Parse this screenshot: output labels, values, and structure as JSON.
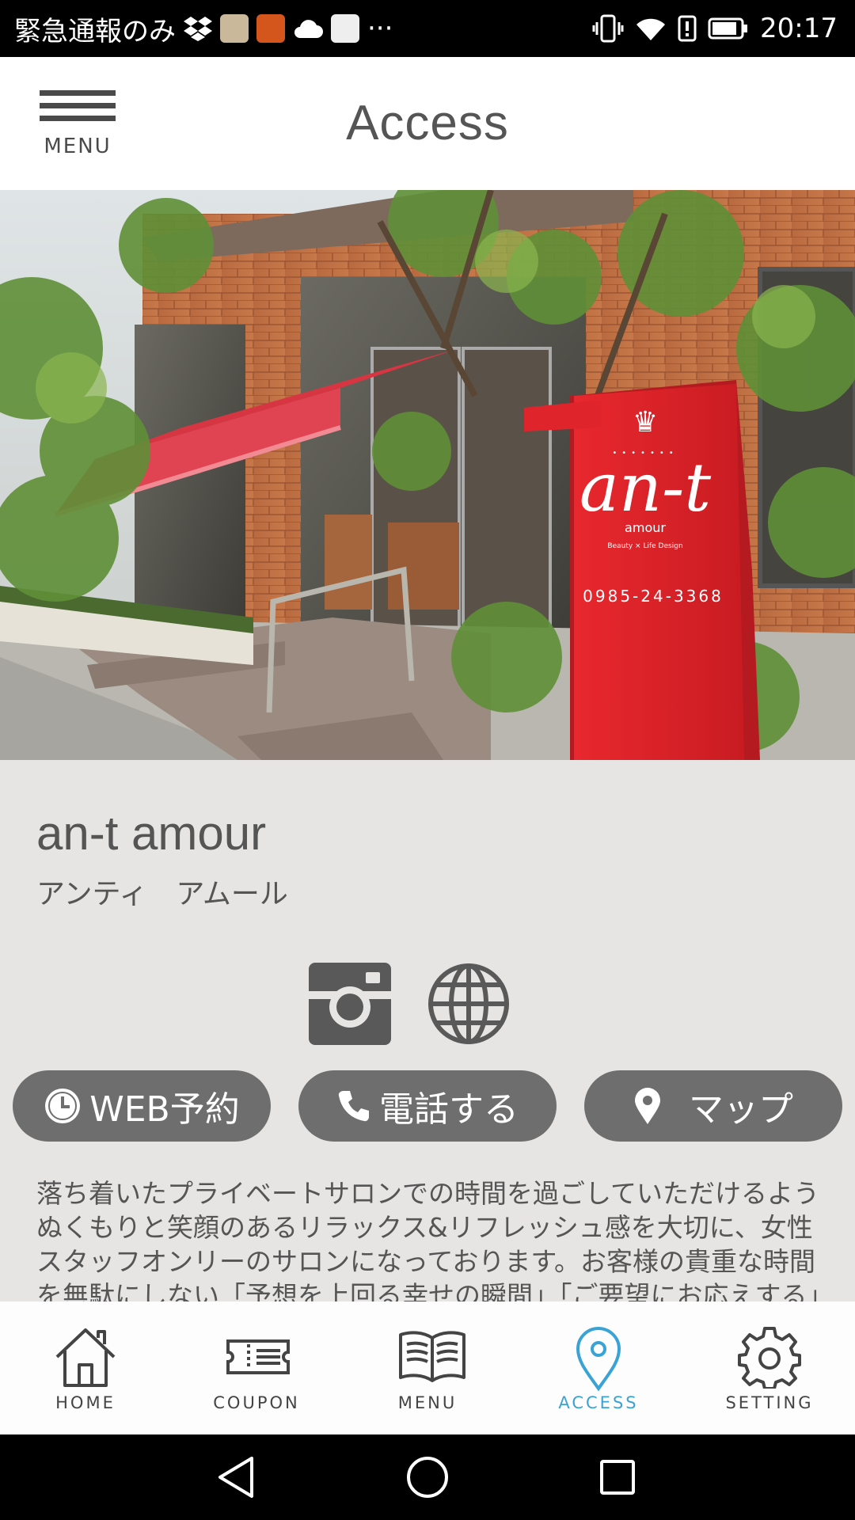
{
  "status_bar": {
    "carrier_text": "緊急通報のみ",
    "overflow": "···",
    "time": "20:17",
    "icons": [
      "dropbox-icon",
      "allure-app-icon",
      "app-icon",
      "cloud-icon",
      "lekiya-app-icon",
      "vibrate-icon",
      "wifi-icon",
      "alert-icon",
      "battery-icon"
    ]
  },
  "header": {
    "menu_label": "MENU",
    "title": "Access"
  },
  "hero": {
    "sign_brand": "an-t",
    "sign_sub": "amour",
    "sign_tagline": "Beauty × Life Design",
    "sign_phone": "0985-24-3368"
  },
  "shop": {
    "name": "an-t amour",
    "kana": "アンティ　アムール"
  },
  "social": [
    "instagram-icon",
    "globe-icon"
  ],
  "actions": {
    "web_reserve": "WEB予約",
    "call": "電話する",
    "map": "マップ"
  },
  "description": "落ち着いたプライベートサロンでの時間を過ごしていただけるようぬくもりと笑顔のあるリラックス&リフレッシュ感を大切に、女性スタッフオンリーのサロンになっております。お客様の貴重な時間を無駄にしない「予想を上回る幸せの瞬間」「ご要望にお応えする」をコンセプトに、クオリティーの高いデザインで喜びと感動をお届けします。",
  "tabs": [
    {
      "label": "HOME",
      "icon": "home-icon"
    },
    {
      "label": "COUPON",
      "icon": "coupon-icon"
    },
    {
      "label": "MENU",
      "icon": "book-icon"
    },
    {
      "label": "ACCESS",
      "icon": "location-pin-icon",
      "active": true
    },
    {
      "label": "SETTING",
      "icon": "gear-icon"
    }
  ],
  "colors": {
    "accent": "#3aa3d6",
    "pill": "#6e6e6e",
    "background": "#e6e5e4",
    "sign_red": "#e0242b"
  }
}
